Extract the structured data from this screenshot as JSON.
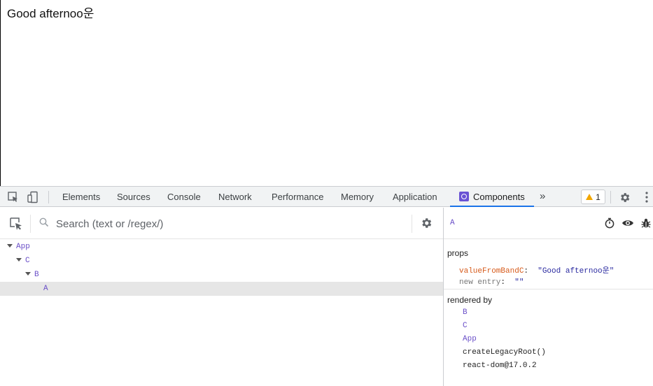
{
  "page": {
    "greeting": "Good afternoo운"
  },
  "devtools": {
    "tabs": [
      "Elements",
      "Sources",
      "Console",
      "Network",
      "Performance",
      "Memory",
      "Application",
      "Components"
    ],
    "active_tab": "Components",
    "more_label": "»",
    "warning_count": "1",
    "accent_color": "#1a73e8",
    "icons": [
      "inspect-element-icon",
      "device-toolbar-icon",
      "settings-gear-icon",
      "kebab-menu-icon"
    ]
  },
  "components": {
    "search": {
      "placeholder": "Search (text or /regex/)",
      "value": ""
    },
    "tree": [
      "App",
      "C",
      "B",
      "A"
    ],
    "selected_component": "A",
    "props_title": "props",
    "props": [
      {
        "key": "valueFromBandC",
        "value": "\"Good afternoo운\""
      }
    ],
    "new_entry": {
      "key": "new entry",
      "value": "\"\""
    },
    "rendered_by_title": "rendered by",
    "rendered_by": [
      "B",
      "C",
      "App",
      "createLegacyRoot()",
      "react-dom@17.0.2"
    ]
  }
}
